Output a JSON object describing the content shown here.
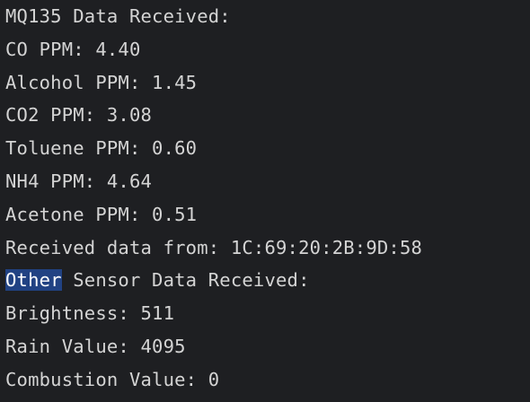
{
  "colors": {
    "background": "#1e1f22",
    "text": "#d4d4d4",
    "selection": "#214283"
  },
  "terminal": {
    "lines": [
      "MQ135 Data Received:",
      "CO PPM: 4.40",
      "Alcohol PPM: 1.45",
      "CO2 PPM: 3.08",
      "Toluene PPM: 0.60",
      "NH4 PPM: 4.64",
      "Acetone PPM: 0.51",
      "Received data from: 1C:69:20:2B:9D:58"
    ],
    "selected_word": "Other",
    "selected_line_rest": " Sensor Data Received:",
    "after_lines": [
      "Brightness: 511",
      "Rain Value: 4095",
      "Combustion Value: 0"
    ]
  }
}
